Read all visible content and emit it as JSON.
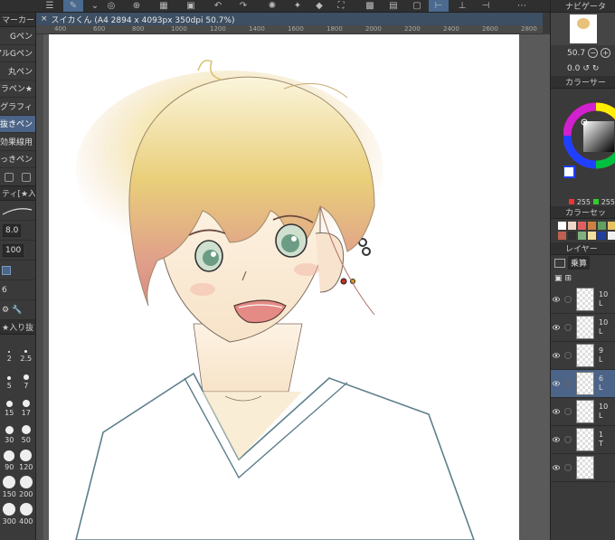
{
  "document_tab": {
    "title": "スイカくん (A4 2894 x 4093px 350dpi 50.7%)",
    "close_glyph": "×"
  },
  "ruler": {
    "ticks": [
      "400",
      "600",
      "800",
      "1000",
      "1200",
      "1400",
      "1600",
      "1800",
      "2000",
      "2200",
      "2400",
      "2600",
      "2800"
    ]
  },
  "left_panel": {
    "header": "マーカー",
    "brushes": [
      "Gペン",
      "アルGペン",
      "丸ペン",
      "グラペン★",
      "グラフィ",
      "入り抜きペン",
      "効果線用",
      "ふっきペン"
    ],
    "selected_brush_index": 5,
    "props_header": "ティ[★入り",
    "brush_size": "8.0",
    "opacity": "100",
    "aa_level": "6",
    "size_header": "★入り抜",
    "sizes": [
      "2",
      "2.5",
      "5",
      "7",
      "15",
      "17",
      "30",
      "50",
      "90",
      "120",
      "150",
      "200",
      "300",
      "400"
    ]
  },
  "right_panel": {
    "navigator_header": "ナビゲータ",
    "zoom_value": "50.7",
    "rotate_value": "0.0",
    "color_header": "カラーサー",
    "rgb_values": [
      "255",
      "255"
    ],
    "palette_header": "カラーセッ",
    "palette_colors": [
      "#ffffff",
      "#f0d8c8",
      "#e06060",
      "#d08040",
      "#60a060",
      "#e8c060",
      "#c06050",
      "#303030",
      "#80b080",
      "#f0e0a0",
      "#2040a0",
      "#f0f0f0"
    ],
    "layer_header": "レイヤー",
    "blend_mode": "乗算",
    "layers": [
      {
        "label": "10",
        "sub": "L"
      },
      {
        "label": "10",
        "sub": "L"
      },
      {
        "label": "9",
        "sub": "L"
      },
      {
        "label": "6",
        "sub": "L"
      },
      {
        "label": "10",
        "sub": "L"
      },
      {
        "label": "1",
        "sub": "T"
      },
      {
        "label": "",
        "sub": ""
      }
    ],
    "selected_layer_index": 3
  },
  "colors": {
    "accent": "#4b6487",
    "panel": "#3a3a3a"
  }
}
